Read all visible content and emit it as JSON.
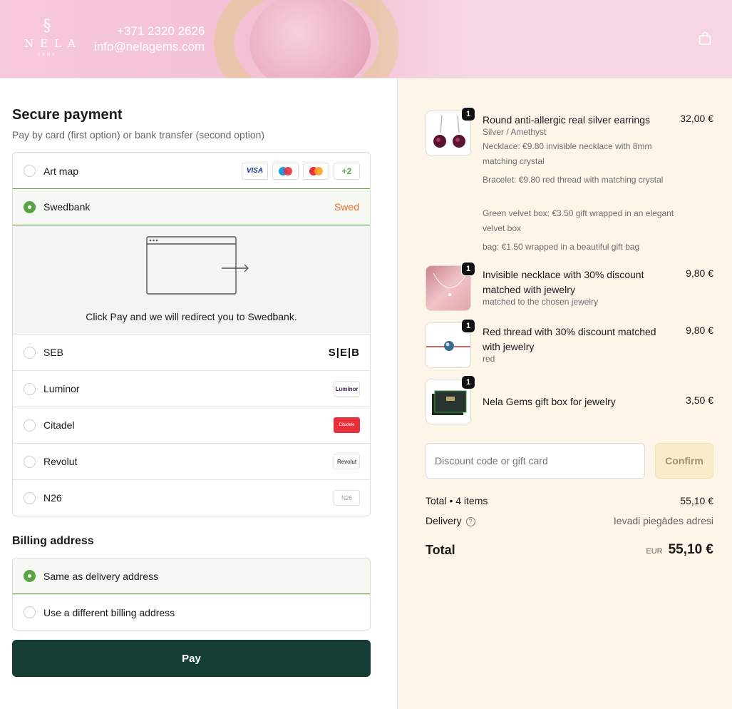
{
  "header": {
    "logo_mark": "§",
    "logo_word": "NELA",
    "logo_sub": "GEMS",
    "phone": "+371 2320 2626",
    "email": "info@nelagems.com"
  },
  "payment": {
    "title": "Secure payment",
    "subtitle": "Pay by card (first option) or bank transfer (second option)",
    "options": [
      {
        "label": "Art map"
      },
      {
        "label": "Swedbank",
        "brand": "Swed"
      },
      {
        "label": "SEB",
        "brand": "S|E|B"
      },
      {
        "label": "Luminor",
        "brand": "Luminor"
      },
      {
        "label": "Citadel",
        "brand": "Citadele"
      },
      {
        "label": "Revolut",
        "brand": "Revolut"
      },
      {
        "label": "N26",
        "brand": "N26"
      }
    ],
    "cards": {
      "visa": "VISA",
      "more": "+2"
    },
    "redirect_text": "Click Pay and we will redirect you to Swedbank."
  },
  "billing": {
    "title": "Billing address",
    "same": "Same as delivery address",
    "different": "Use a different billing address"
  },
  "pay_button": "Pay",
  "items": [
    {
      "qty": "1",
      "name": "Round anti-allergic real silver earrings",
      "price": "32,00 €",
      "variant": "Silver / Amethyst",
      "extras": [
        "Necklace: €9.80 invisible necklace with 8mm matching crystal",
        "Bracelet: €9.80 red thread with matching crystal",
        "Green velvet box: €3.50 gift wrapped in an elegant velvet box",
        "bag: €1.50 wrapped in a beautiful gift bag"
      ]
    },
    {
      "qty": "1",
      "name": "Invisible necklace with 30% discount matched with jewelry",
      "price": "9,80 €",
      "variant": "matched to the chosen jewelry"
    },
    {
      "qty": "1",
      "name": "Red thread with 30% discount matched with jewelry",
      "price": "9,80 €",
      "variant": "red"
    },
    {
      "qty": "1",
      "name": "Nela Gems gift box for jewelry",
      "price": "3,50 €"
    }
  ],
  "discount": {
    "placeholder": "Discount code or gift card",
    "button": "Confirm"
  },
  "summary": {
    "subtotal_label": "Total • 4 items",
    "subtotal_value": "55,10 €",
    "delivery_label": "Delivery",
    "delivery_value": "Ievadi piegādes adresi",
    "total_label": "Total",
    "currency": "EUR",
    "total_value": "55,10 €"
  },
  "colors": {
    "accent_green": "#5aa543",
    "pay_button": "#143d33",
    "summary_bg": "#fdf5e8",
    "swed_orange": "#ee7023",
    "citadele_red": "#e8303a"
  }
}
